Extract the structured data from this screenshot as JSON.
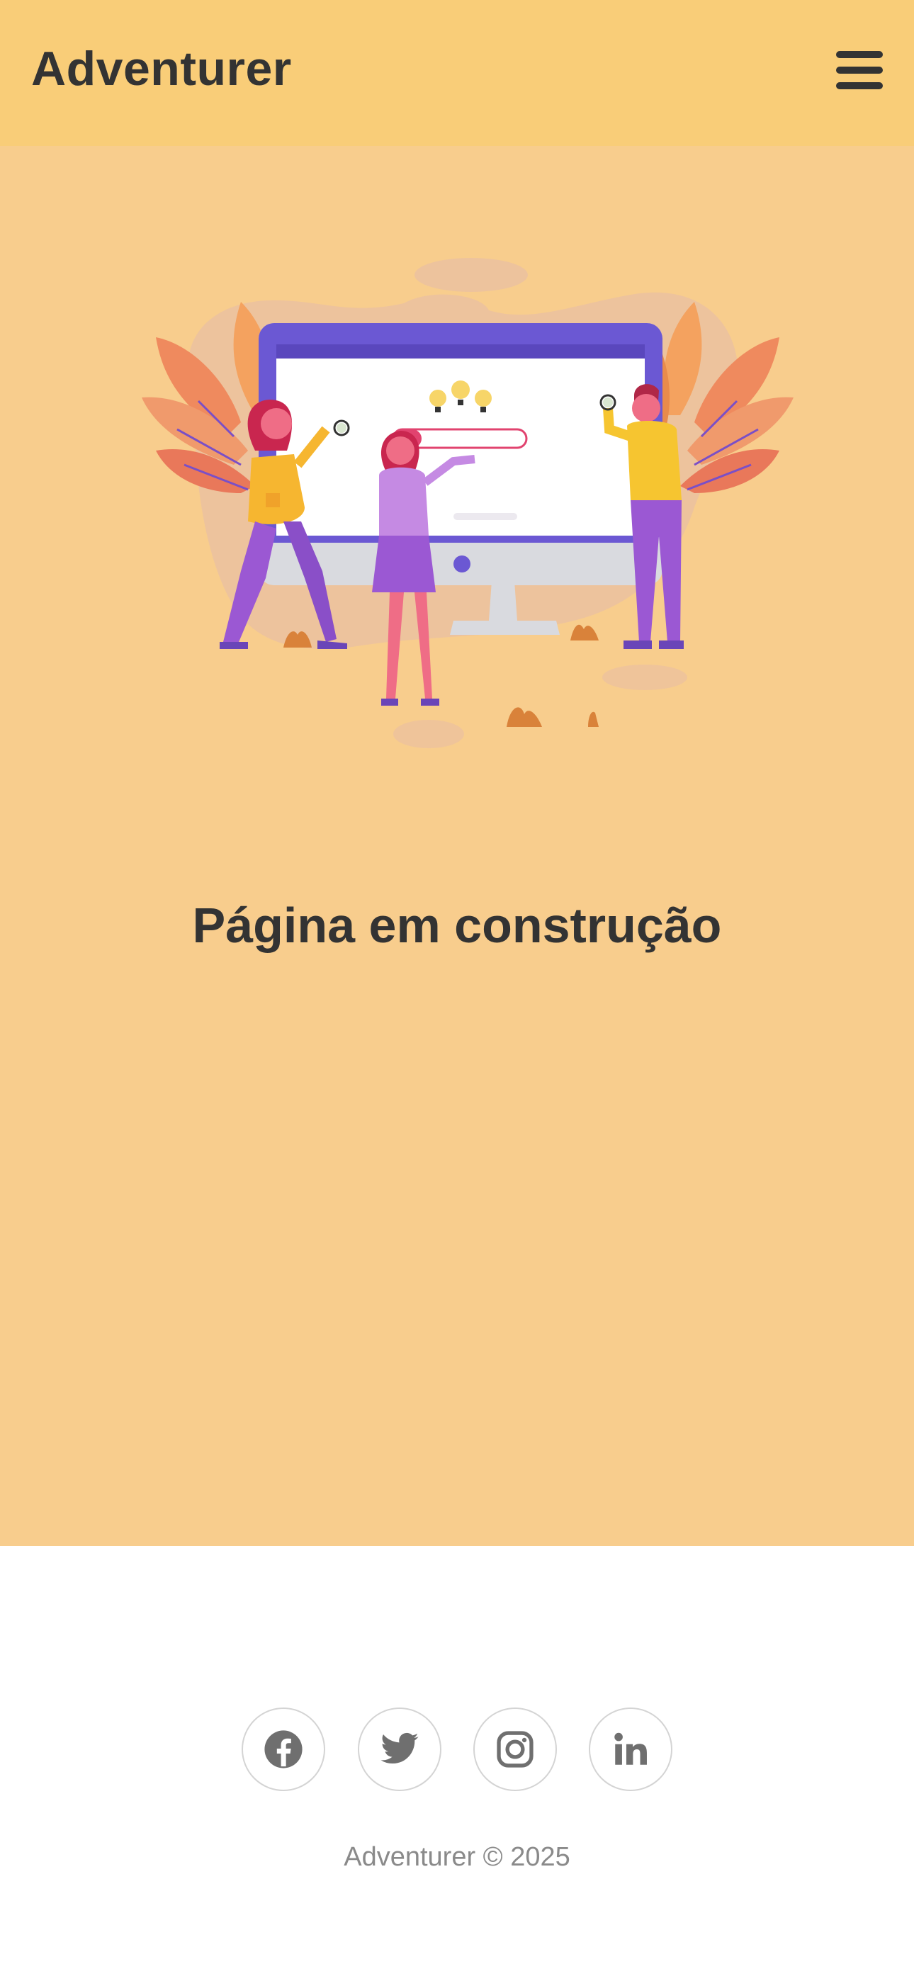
{
  "header": {
    "brand": "Adventurer",
    "menu_icon": "hamburger-menu-icon"
  },
  "main": {
    "illustration": "people-searching-website-illustration",
    "title": "Página em construção"
  },
  "footer": {
    "social": [
      {
        "name": "Facebook",
        "icon": "facebook-icon"
      },
      {
        "name": "Twitter",
        "icon": "twitter-icon"
      },
      {
        "name": "Instagram",
        "icon": "instagram-icon"
      },
      {
        "name": "LinkedIn",
        "icon": "linkedin-icon"
      }
    ],
    "copyright": "Adventurer © 2025"
  },
  "colors": {
    "header_bg": "#f9cd78",
    "main_bg": "#f8cd8d",
    "text": "#333333",
    "footer_text": "#8a8a8a",
    "accent_purple": "#6c5ad6"
  }
}
